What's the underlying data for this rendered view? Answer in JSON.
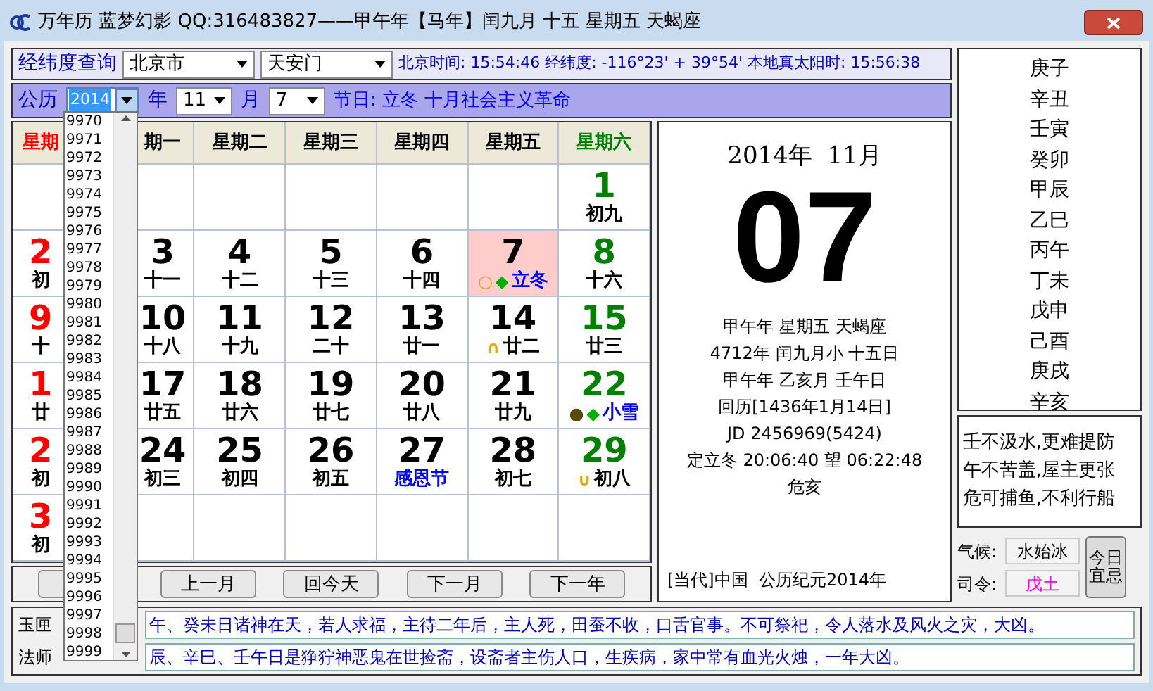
{
  "window": {
    "title": "万年历 蓝梦幻影 QQ:316483827——甲午年【马年】闰九月 十五 星期五 天蝎座"
  },
  "location": {
    "label": "经纬度查询",
    "city": "北京市",
    "place": "天安门",
    "info": "北京时间: 15:54:46 经纬度: -116°23' + 39°54' 本地真太阳时: 15:56:38"
  },
  "date_bar": {
    "label": "公历",
    "year": "2014",
    "year_unit": "年",
    "month": "11",
    "month_unit": "月",
    "day": "7",
    "festival": "节日: 立冬 十月社会主义革命"
  },
  "year_dropdown": {
    "items": [
      "9970",
      "9971",
      "9972",
      "9973",
      "9974",
      "9975",
      "9976",
      "9977",
      "9978",
      "9979",
      "9980",
      "9981",
      "9982",
      "9983",
      "9984",
      "9985",
      "9986",
      "9987",
      "9988",
      "9989",
      "9990",
      "9991",
      "9992",
      "9993",
      "9994",
      "9995",
      "9996",
      "9997",
      "9998",
      "9999"
    ]
  },
  "calendar": {
    "weekdays": [
      {
        "label": "星期",
        "kind": "sun"
      },
      {
        "label": "期一",
        "kind": "work"
      },
      {
        "label": "星期二",
        "kind": "work"
      },
      {
        "label": "星期三",
        "kind": "work"
      },
      {
        "label": "星期四",
        "kind": "work"
      },
      {
        "label": "星期五",
        "kind": "work"
      },
      {
        "label": "星期六",
        "kind": "sat"
      }
    ],
    "weeks": [
      [
        {
          "kind": "empty"
        },
        {
          "kind": "empty"
        },
        {
          "kind": "empty"
        },
        {
          "kind": "empty"
        },
        {
          "kind": "empty"
        },
        {
          "kind": "empty"
        },
        {
          "kind": "day",
          "day": "1",
          "lunar": "初九",
          "festival": false,
          "selected": false
        }
      ],
      [
        {
          "day": "2",
          "lunar": "初",
          "festival": false,
          "selected": false
        },
        {
          "day": "3",
          "lunar": "十一",
          "festival": false,
          "selected": false
        },
        {
          "day": "4",
          "lunar": "十二",
          "festival": false,
          "selected": false
        },
        {
          "day": "5",
          "lunar": "十三",
          "festival": false,
          "selected": false
        },
        {
          "day": "6",
          "lunar": "十四",
          "festival": false,
          "selected": false
        },
        {
          "day": "7",
          "lunar": "立冬",
          "festival": true,
          "selected": true,
          "markers": [
            {
              "symbol": "○",
              "color": "#e8a800"
            },
            {
              "symbol": "◆",
              "color": "#00b000"
            }
          ]
        },
        {
          "day": "8",
          "lunar": "十六",
          "festival": false,
          "selected": false
        }
      ],
      [
        {
          "day": "9",
          "lunar": "十",
          "festival": false,
          "selected": false
        },
        {
          "day": "10",
          "lunar": "十八",
          "festival": false,
          "selected": false
        },
        {
          "day": "11",
          "lunar": "十九",
          "festival": false,
          "selected": false
        },
        {
          "day": "12",
          "lunar": "二十",
          "festival": false,
          "selected": false
        },
        {
          "day": "13",
          "lunar": "廿一",
          "festival": false,
          "selected": false
        },
        {
          "day": "14",
          "lunar": "廿二",
          "festival": false,
          "selected": false,
          "markers": [
            {
              "symbol": "∩",
              "color": "#e8a800"
            }
          ]
        },
        {
          "day": "15",
          "lunar": "廿三",
          "festival": false,
          "selected": false
        }
      ],
      [
        {
          "day": "1",
          "lunar": "廿",
          "festival": false,
          "selected": false
        },
        {
          "day": "17",
          "lunar": "廿五",
          "festival": false,
          "selected": false
        },
        {
          "day": "18",
          "lunar": "廿六",
          "festival": false,
          "selected": false
        },
        {
          "day": "19",
          "lunar": "廿七",
          "festival": false,
          "selected": false
        },
        {
          "day": "20",
          "lunar": "廿八",
          "festival": false,
          "selected": false
        },
        {
          "day": "21",
          "lunar": "廿九",
          "festival": false,
          "selected": false
        },
        {
          "day": "22",
          "lunar": "小雪",
          "festival": true,
          "selected": false,
          "markers": [
            {
              "symbol": "●",
              "color": "#5a4a10"
            },
            {
              "symbol": "◆",
              "color": "#00b000"
            }
          ]
        }
      ],
      [
        {
          "day": "2",
          "lunar": "初",
          "festival": false,
          "selected": false
        },
        {
          "day": "24",
          "lunar": "初三",
          "festival": false,
          "selected": false
        },
        {
          "day": "25",
          "lunar": "初四",
          "festival": false,
          "selected": false
        },
        {
          "day": "26",
          "lunar": "初五",
          "festival": false,
          "selected": false
        },
        {
          "day": "27",
          "lunar": "感恩节",
          "festival": true,
          "selected": false
        },
        {
          "day": "28",
          "lunar": "初七",
          "festival": false,
          "selected": false
        },
        {
          "day": "29",
          "lunar": "初八",
          "festival": false,
          "selected": false,
          "markers": [
            {
              "symbol": "∪",
              "color": "#e8a800"
            }
          ]
        }
      ],
      [
        {
          "day": "3",
          "lunar": "初",
          "festival": false,
          "selected": false
        },
        {
          "kind": "empty"
        },
        {
          "kind": "empty"
        },
        {
          "kind": "empty"
        },
        {
          "kind": "empty"
        },
        {
          "kind": "empty"
        },
        {
          "kind": "empty"
        }
      ]
    ]
  },
  "nav_buttons": [
    "上一月",
    "回今天",
    "下一月",
    "下一年"
  ],
  "day_panel": {
    "year_month": "2014年  11月",
    "day": "07",
    "lines": [
      "甲午年 星期五 天蝎座",
      "4712年 闰九月小 十五日",
      "甲午年 乙亥月 壬午日",
      "回历[1436年1月14日]",
      "JD 2456969(5424)",
      "定立冬 20:06:40 望 06:22:48",
      "危亥"
    ],
    "era": "[当代]中国  公历纪元2014年"
  },
  "ganzhi": [
    "庚子",
    "辛丑",
    "壬寅",
    "癸卯",
    "甲辰",
    "乙巳",
    "丙午",
    "丁未",
    "戊申",
    "己酉",
    "庚戌",
    "辛亥"
  ],
  "verse": [
    "壬不汲水,更难提防",
    "午不苦盖,屋主更张",
    "危可捕鱼,不利行船"
  ],
  "climate": {
    "label": "气候:",
    "value": "水始冰"
  },
  "command": {
    "label": "司令:",
    "value": "戊土"
  },
  "today_button": [
    "今日",
    "宜忌"
  ],
  "notes": [
    {
      "label": "玉匣",
      "text": "午、癸未日诸神在天，若人求福，主待二年后，主人死，田蚕不收，口舌官事。不可祭祀，令人落水及风火之灾，大凶。"
    },
    {
      "label": "法师",
      "text": "辰、辛巳、壬午日是狰狞神恶鬼在世捡斋，设斋者主伤人口，生疾病，家中常有血光火烛，一年大凶。"
    }
  ]
}
